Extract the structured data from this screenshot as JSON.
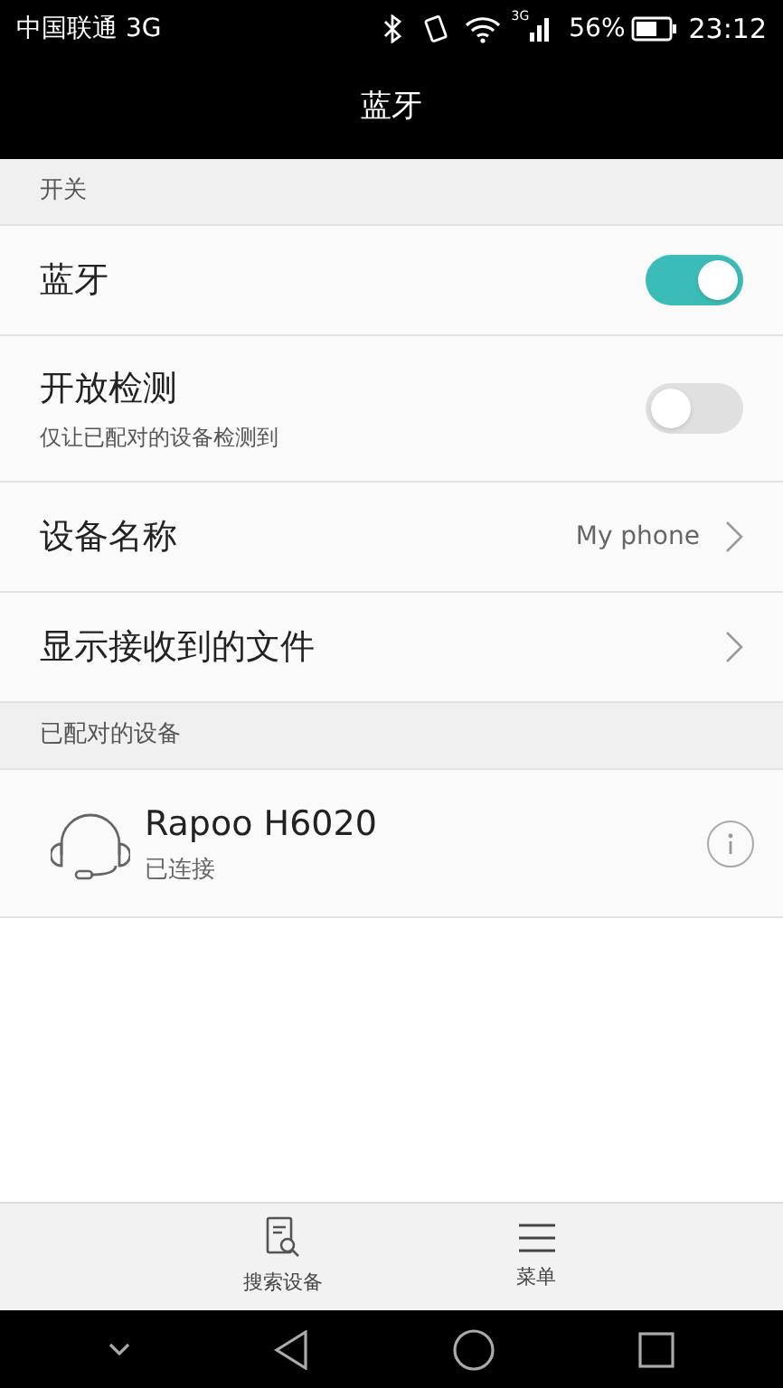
{
  "status_bar": {
    "carrier": "中国联通 3G",
    "network_label": "3G",
    "battery": "56%",
    "time": "23:12"
  },
  "title": "蓝牙",
  "sections": [
    {
      "header": "开关",
      "rows": [
        {
          "kind": "toggle",
          "label": "蓝牙",
          "on": true
        },
        {
          "kind": "toggle",
          "label": "开放检测",
          "subtitle": "仅让已配对的设备检测到",
          "on": false
        },
        {
          "kind": "link",
          "label": "设备名称",
          "value": "My phone"
        },
        {
          "kind": "link",
          "label": "显示接收到的文件"
        }
      ]
    },
    {
      "header": "已配对的设备",
      "rows": [
        {
          "kind": "device",
          "label": "Rapoo H6020",
          "subtitle": "已连接"
        }
      ]
    }
  ],
  "bottom_actions": [
    {
      "label": "搜索设备",
      "kind": "search"
    },
    {
      "label": "菜单",
      "kind": "menu"
    }
  ]
}
